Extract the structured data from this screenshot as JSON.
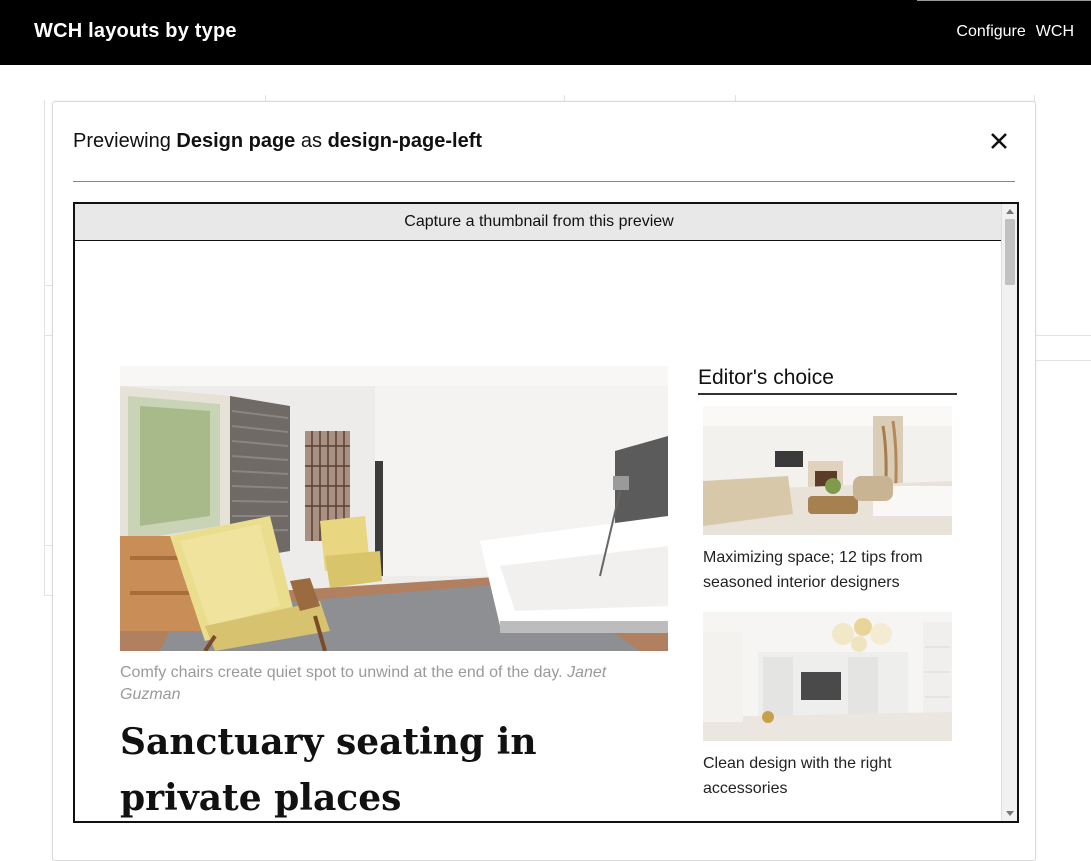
{
  "topbar": {
    "title": "WCH layouts by type",
    "nav": [
      "Configure",
      "WCH"
    ]
  },
  "modal": {
    "prefix": "Previewing ",
    "page_name": "Design page",
    "middle": " as ",
    "layout_name": "design-page-left",
    "close_icon": "close-icon"
  },
  "preview": {
    "capture_label": "Capture a thumbnail from this preview",
    "article": {
      "caption_text": "Comfy chairs create quiet spot to unwind at the end of the day. ",
      "caption_author": "Janet Guzman",
      "headline": "Sanctuary seating in private places"
    },
    "sidebar": {
      "title": "Editor's choice",
      "items": [
        {
          "text": "Maximizing space; 12 tips from seasoned interior designers"
        },
        {
          "text": "Clean design with the right accessories"
        }
      ]
    }
  }
}
